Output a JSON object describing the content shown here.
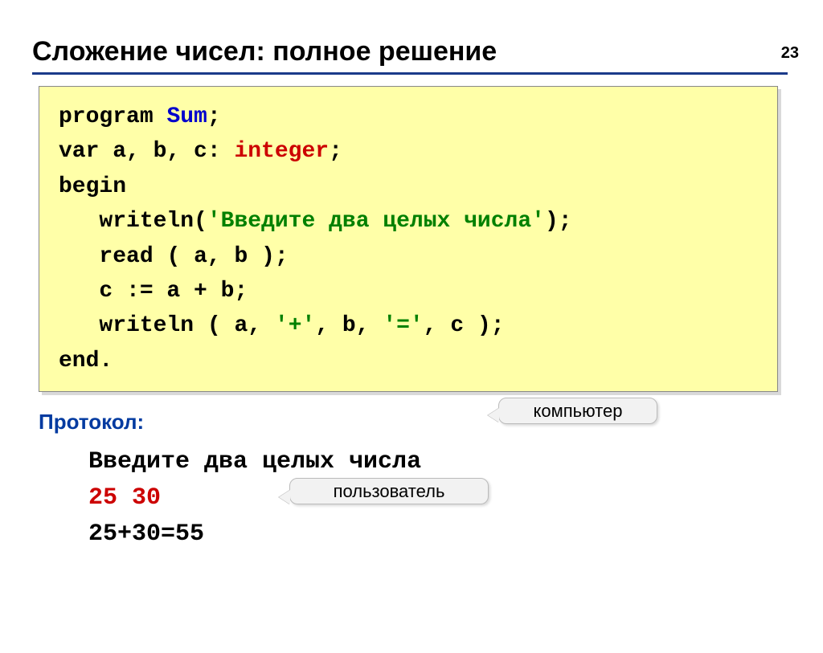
{
  "page_number": "23",
  "title": "Сложение чисел: полное решение",
  "code": {
    "kw_program": "program",
    "prog_name": "Sum",
    "semi": ";",
    "kw_var": "var",
    "var_decl_part": " a, b, c: ",
    "kw_integer": "integer",
    "kw_begin": "begin",
    "kw_writeln1": "writeln",
    "lparen": "(",
    "rparen": ")",
    "prompt_str": "'Введите два целых числа'",
    "kw_read": "read",
    "read_args": " a, b ",
    "assign_line": "   c := a + b;",
    "kw_writeln2": "writeln",
    "out_args_a": " a, ",
    "plus_str": "'+'",
    "out_args_b": ", b, ",
    "eq_str": "'='",
    "out_args_c": ", c ",
    "kw_end": "end",
    "dot": "."
  },
  "protocol_label": "Протокол:",
  "output": {
    "line1": "Введите два целых числа",
    "line2": "25 30",
    "line3": "25+30=55"
  },
  "callouts": {
    "computer": "компьютер",
    "user": "пользователь"
  }
}
